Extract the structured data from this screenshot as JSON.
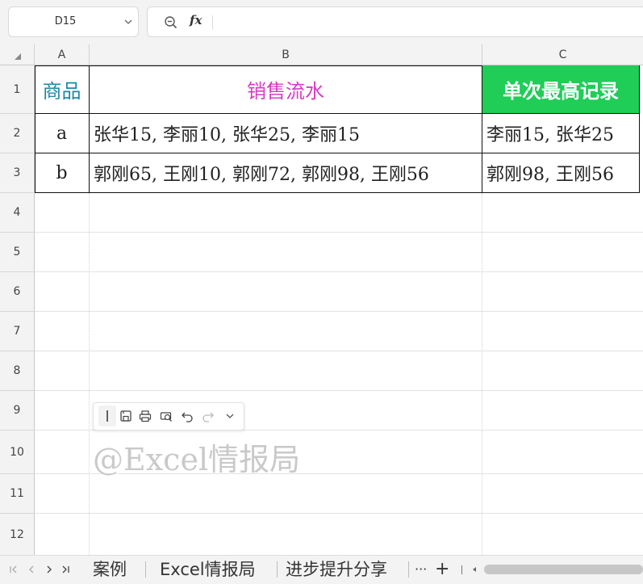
{
  "name_box": {
    "value": "D15"
  },
  "formula_bar": {
    "fx_label": "fx",
    "formula": ""
  },
  "columns": [
    "A",
    "B",
    "C"
  ],
  "rows": [
    "1",
    "2",
    "3",
    "4",
    "5",
    "6",
    "7",
    "8",
    "9",
    "10",
    "11",
    "12"
  ],
  "table": {
    "headers": [
      "商品",
      "销售流水",
      "单次最高记录"
    ],
    "data": [
      [
        "a",
        "张华15, 李丽10, 张华25, 李丽15",
        "李丽15, 张华25"
      ],
      [
        "b",
        "郭刚65, 王刚10, 郭刚72, 郭刚98, 王刚56",
        "郭刚98, 王刚56"
      ]
    ]
  },
  "colors": {
    "header_a": "#1a8aa6",
    "header_b": "#d93bc4",
    "header_c_bg": "#1fcd57",
    "header_c_text": "#ffffff"
  },
  "watermark": "@Excel情报局",
  "float_toolbar": {
    "icons": [
      "text-cursor-icon",
      "save-icon",
      "print-icon",
      "print-preview-icon",
      "undo-icon",
      "redo-icon",
      "chevron-down-icon"
    ]
  },
  "sheet_tabs": [
    "案例",
    "Excel情报局",
    "进步提升分享"
  ],
  "tab_overflow": "···",
  "add_sheet": "+"
}
